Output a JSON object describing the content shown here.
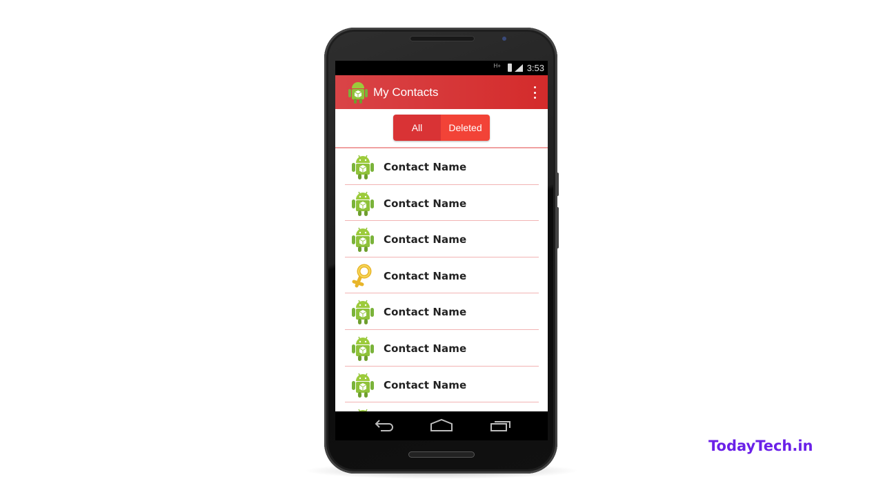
{
  "status_bar": {
    "network_label": "H+",
    "time": "3:53"
  },
  "app_bar": {
    "title": "My Contacts",
    "logo_icon": "android-icon",
    "menu_icon": "overflow-menu-icon"
  },
  "tabs": {
    "items": [
      {
        "label": "All",
        "selected": false
      },
      {
        "label": "Deleted",
        "selected": true
      }
    ]
  },
  "contacts": [
    {
      "name": "Contact Name",
      "icon": "android-icon"
    },
    {
      "name": "Contact Name",
      "icon": "android-icon"
    },
    {
      "name": "Contact Name",
      "icon": "android-icon"
    },
    {
      "name": "Contact Name",
      "icon": "female-symbol-icon"
    },
    {
      "name": "Contact Name",
      "icon": "android-icon"
    },
    {
      "name": "Contact Name",
      "icon": "android-icon"
    },
    {
      "name": "Contact Name",
      "icon": "android-icon"
    },
    {
      "name": "",
      "icon": "android-icon"
    }
  ],
  "nav_bar": {
    "back_icon": "back-icon",
    "home_icon": "home-icon",
    "recents_icon": "recents-icon"
  },
  "watermark": "TodayTech.in",
  "colors": {
    "app_bar": "#d42b2b",
    "tab_all": "#d93335",
    "tab_deleted": "#f24337",
    "divider": "#f2b3b3",
    "watermark": "#6b21e8"
  }
}
